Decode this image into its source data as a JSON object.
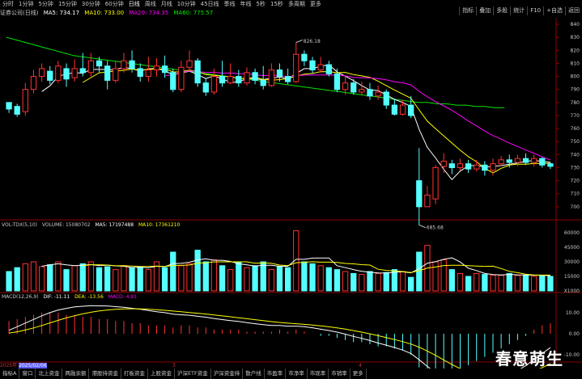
{
  "toolbar": {
    "periods": [
      "分时",
      "1分钟",
      "5分钟",
      "15分钟",
      "30分钟",
      "60分钟",
      "日线",
      "周线",
      "月线",
      "10分钟",
      "45日线",
      "季线",
      "年线",
      "5秒",
      "15秒",
      "多周期",
      "更多"
    ],
    "selected": "日线",
    "right_buttons": [
      "指标",
      "叠加",
      "多股",
      "统计",
      "F10",
      "+自选",
      "返回"
    ]
  },
  "info": {
    "stock": "证券公司(日线)",
    "ma5": "MA5: 734.17",
    "ma10": "MA10: 733.00",
    "ma20": "MA20: 734.35",
    "ma60": "MA60: 775.57"
  },
  "colors": {
    "up": "#ff3232",
    "down": "#54ffff",
    "ma5": "#ffffff",
    "ma10": "#ffff00",
    "ma20": "#ff00ff",
    "ma60": "#00e600",
    "grid": "#8b0000"
  },
  "price_axis": {
    "labels": [
      "840",
      "830",
      "820",
      "810",
      "800",
      "790",
      "780",
      "770",
      "760",
      "750",
      "740",
      "730",
      "720",
      "710",
      "700"
    ],
    "min": 690,
    "max": 845
  },
  "annotations": {
    "high": "826.18",
    "low": "685.68"
  },
  "vol": {
    "label": "VOL-TDX(5,10)",
    "volume": "VOLUME: 15080702",
    "ma5": "MA5: 17197488",
    "ma10": "MA10: 17361210",
    "axis": [
      "60000",
      "45000",
      "30000",
      "15000",
      "X1000"
    ]
  },
  "macd": {
    "label": "MACD(12,26,9)",
    "dif": "DIF: -11.11",
    "dea": "DEA: -13.56",
    "macd": "MACD: 4.91",
    "axis": [
      "10.00",
      "0.00",
      "-10.00"
    ]
  },
  "dates": {
    "year": "2025年",
    "date": "2025/02/06",
    "marks": [
      "3",
      "4"
    ]
  },
  "tabs": [
    "指标A",
    "窗口",
    "北上资金",
    "两融余额",
    "港股持资金",
    "打板资金",
    "上股资金",
    "沪深ETF资金",
    "沪深资金持",
    "散户线",
    "市盈率",
    "市净率",
    "市现率",
    "市销率",
    "更多"
  ],
  "watermark": "春意萌生",
  "chart_data": {
    "type": "candlestick",
    "candles": [
      [
        780,
        775,
        778,
        772
      ],
      [
        777,
        771,
        779,
        769
      ],
      [
        773,
        790,
        795,
        770
      ],
      [
        790,
        800,
        805,
        787
      ],
      [
        800,
        806,
        810,
        796
      ],
      [
        804,
        797,
        808,
        794
      ],
      [
        797,
        808,
        812,
        795
      ],
      [
        806,
        798,
        810,
        792
      ],
      [
        799,
        806,
        813,
        796
      ],
      [
        806,
        803,
        818,
        800
      ],
      [
        803,
        812,
        818,
        800
      ],
      [
        812,
        808,
        815,
        803
      ],
      [
        808,
        797,
        812,
        790
      ],
      [
        797,
        806,
        812,
        795
      ],
      [
        806,
        812,
        818,
        803
      ],
      [
        812,
        806,
        820,
        803
      ],
      [
        806,
        800,
        810,
        796
      ],
      [
        800,
        805,
        815,
        796
      ],
      [
        805,
        808,
        814,
        800
      ],
      [
        808,
        803,
        816,
        799
      ],
      [
        803,
        790,
        806,
        788
      ],
      [
        790,
        807,
        812,
        788
      ],
      [
        807,
        812,
        820,
        804
      ],
      [
        812,
        795,
        814,
        792
      ],
      [
        795,
        788,
        799,
        785
      ],
      [
        788,
        800,
        806,
        786
      ],
      [
        800,
        795,
        812,
        792
      ],
      [
        795,
        800,
        810,
        794
      ],
      [
        800,
        795,
        805,
        792
      ],
      [
        795,
        803,
        807,
        793
      ],
      [
        803,
        797,
        806,
        794
      ],
      [
        797,
        793,
        808,
        790
      ],
      [
        793,
        805,
        810,
        792
      ],
      [
        805,
        800,
        810,
        796
      ],
      [
        800,
        796,
        806,
        794
      ],
      [
        796,
        817,
        826,
        795
      ],
      [
        817,
        812,
        820,
        808
      ],
      [
        812,
        805,
        815,
        802
      ],
      [
        805,
        809,
        815,
        803
      ],
      [
        809,
        802,
        812,
        800
      ],
      [
        802,
        790,
        806,
        788
      ],
      [
        790,
        795,
        800,
        786
      ],
      [
        795,
        788,
        798,
        786
      ],
      [
        788,
        790,
        796,
        786
      ],
      [
        790,
        785,
        795,
        782
      ],
      [
        785,
        788,
        793,
        782
      ],
      [
        788,
        778,
        790,
        775
      ],
      [
        778,
        771,
        783,
        770
      ],
      [
        771,
        778,
        782,
        770
      ],
      [
        778,
        770,
        785,
        768
      ],
      [
        720,
        700,
        745,
        686
      ],
      [
        700,
        709,
        716,
        700
      ],
      [
        706,
        730,
        732,
        702
      ],
      [
        731,
        735,
        741,
        726
      ],
      [
        733,
        730,
        736,
        725
      ],
      [
        730,
        733,
        737,
        728
      ],
      [
        733,
        729,
        736,
        726
      ],
      [
        729,
        732,
        736,
        727
      ],
      [
        732,
        728,
        735,
        724
      ],
      [
        728,
        733,
        737,
        724
      ],
      [
        733,
        736,
        739,
        731
      ],
      [
        736,
        734,
        740,
        730
      ],
      [
        734,
        737,
        740,
        731
      ],
      [
        737,
        734,
        741,
        732
      ],
      [
        734,
        737,
        740,
        731
      ],
      [
        737,
        732,
        738,
        730
      ],
      [
        733,
        731,
        734,
        729
      ]
    ],
    "ma60": [
      830,
      828,
      826,
      824,
      822,
      820,
      818,
      816,
      815,
      814,
      813,
      812,
      811,
      810,
      809,
      808,
      807,
      806,
      805,
      804,
      803,
      802,
      801,
      800,
      799,
      798,
      797,
      796,
      795,
      794,
      793,
      792,
      791,
      790,
      789,
      788,
      787,
      786,
      785,
      784,
      783,
      782,
      781,
      780,
      780,
      779,
      779,
      778,
      778,
      777,
      777,
      776,
      776
    ],
    "volume": [
      20000,
      24000,
      28000,
      30000,
      25000,
      27000,
      30000,
      22000,
      26000,
      28000,
      30000,
      24000,
      25000,
      22000,
      26000,
      24000,
      25000,
      22000,
      30000,
      24000,
      40000,
      26000,
      28000,
      42000,
      30000,
      32000,
      26000,
      22000,
      30000,
      24000,
      26000,
      30000,
      22000,
      25000,
      24000,
      62000,
      30000,
      28000,
      26000,
      24000,
      22000,
      20000,
      18000,
      17000,
      20000,
      18000,
      19000,
      22000,
      20000,
      14000,
      40000,
      47000,
      30000,
      32000,
      22000,
      18000,
      15000,
      18000,
      17000,
      16000,
      16000,
      18000,
      16000,
      16000,
      15000,
      16000,
      15000
    ],
    "macd": [
      6,
      7,
      8,
      9,
      10,
      10,
      10,
      9,
      9,
      8,
      8,
      7,
      7,
      6,
      6,
      5,
      5,
      4,
      4,
      4,
      3,
      4,
      4,
      3,
      3,
      2,
      2,
      2,
      2,
      1,
      1,
      1,
      1,
      2,
      1,
      2,
      1,
      0,
      -1,
      -1,
      -2,
      -3,
      -4,
      -4,
      -5,
      -6,
      -6,
      -7,
      -8,
      -10,
      -16,
      -18,
      -19,
      -20,
      -19,
      -17,
      -15,
      -13,
      -11,
      -9,
      -7,
      -5,
      -3,
      -1,
      2,
      4,
      5
    ]
  }
}
